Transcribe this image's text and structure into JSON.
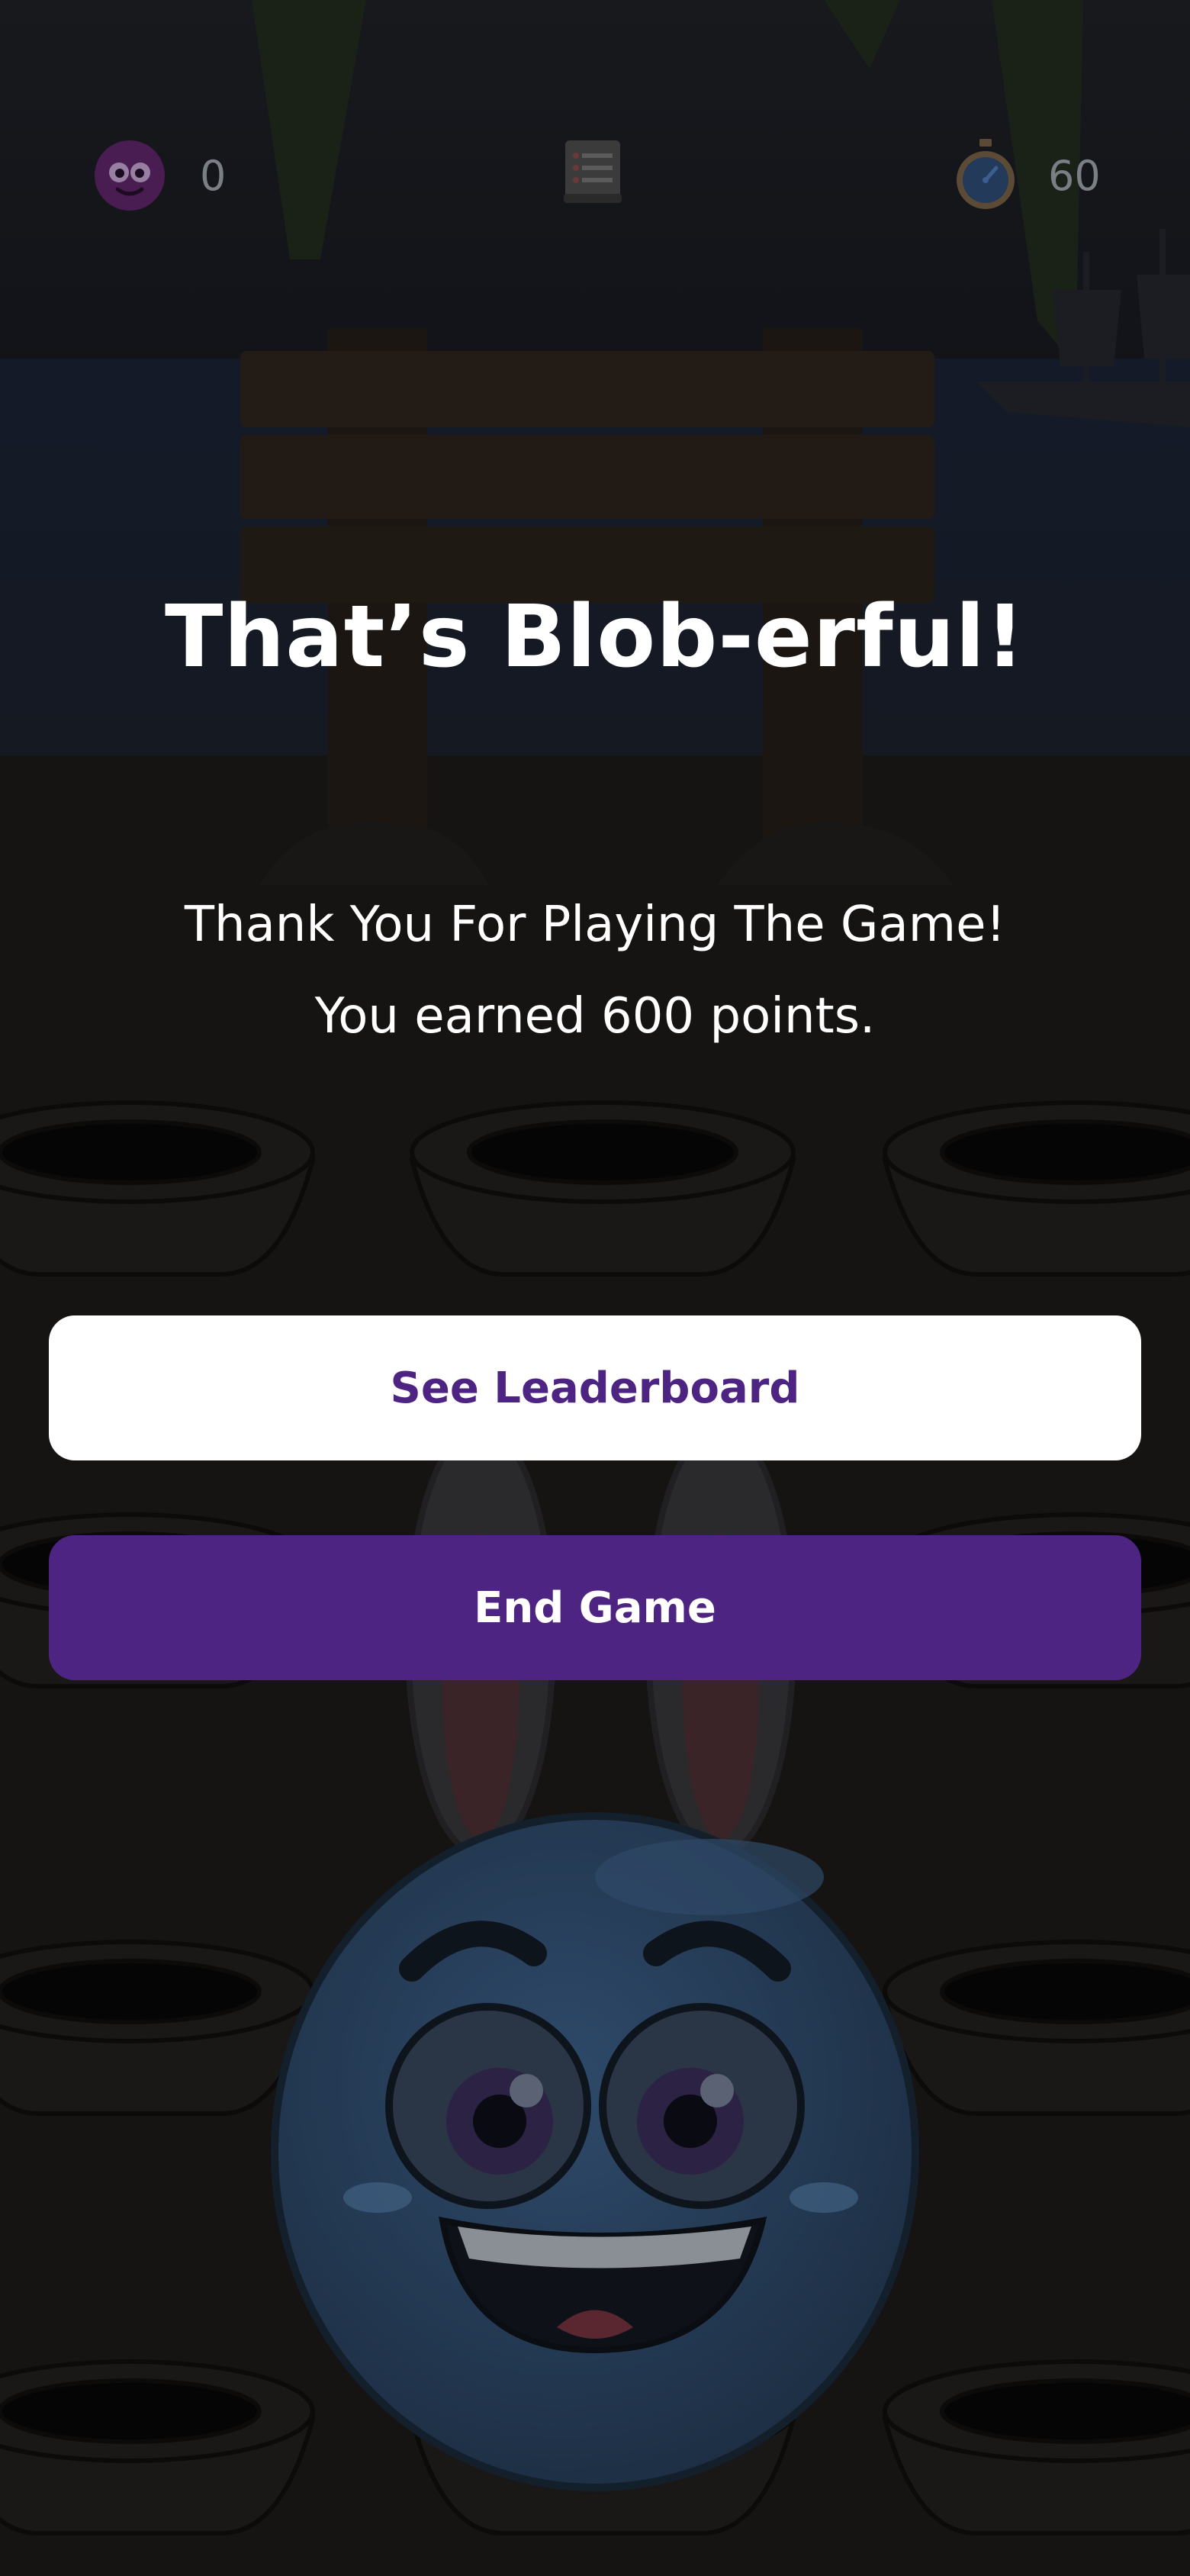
{
  "hud": {
    "score": "0",
    "timer": "60",
    "score_icon": "purple-blob-avatar",
    "menu_icon": "scroll-list-icon",
    "timer_icon": "stopwatch-icon"
  },
  "modal": {
    "title": "That’s Blob-erful!",
    "line1": "Thank You For Playing The Game!",
    "line2": "You earned 600 points.",
    "leaderboard_label": "See Leaderboard",
    "end_label": "End Game"
  },
  "colors": {
    "accent": "#4e2483",
    "overlay": "#0b0b0c",
    "button_light": "#ffffff"
  }
}
